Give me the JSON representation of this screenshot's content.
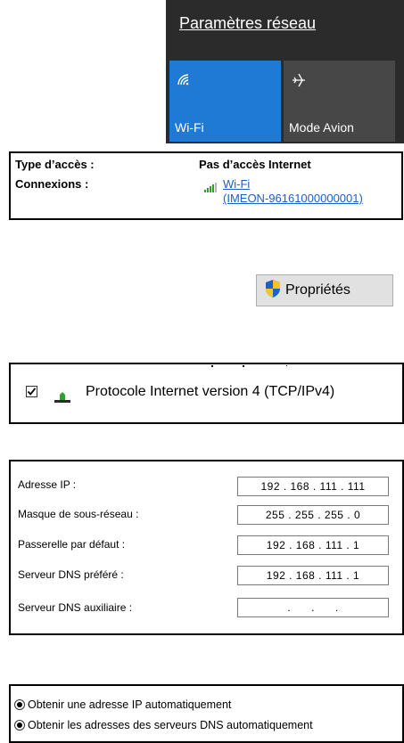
{
  "flyout": {
    "title": "Paramètres réseau",
    "tiles": [
      {
        "label": "Wi-Fi",
        "icon": "wifi-icon",
        "active": true,
        "color": "#1f7ad6"
      },
      {
        "label": "Mode Avion",
        "icon": "airplane-icon",
        "active": false,
        "color": "#474747"
      }
    ]
  },
  "access": {
    "type_label": "Type d’accès :",
    "type_value": "Pas d’accès Internet",
    "connections_label": "Connexions :",
    "connection_link_line1": "Wi-Fi",
    "connection_link_line2": "(IMEON-96161000000001)",
    "icon": "wifi-signal-icon"
  },
  "properties_button": {
    "label": "Propriétés",
    "icon": "uac-shield-icon"
  },
  "protocol": {
    "label": "Protocole Internet version 4 (TCP/IPv4)",
    "checked": true,
    "icon": "network-protocol-icon"
  },
  "ip_settings": [
    {
      "label": "Adresse IP :",
      "value": "192 . 168 . 111 . 111"
    },
    {
      "label": "Masque de sous-réseau :",
      "value": "255 . 255 . 255 .  0"
    },
    {
      "label": "Passerelle par défaut :",
      "value": "192 . 168 . 111 .  1"
    },
    {
      "label": "Serveur DNS préféré :",
      "value": "192 . 168 . 111 .  1"
    },
    {
      "label": "Serveur DNS auxiliaire :",
      "value": " .      .      . "
    }
  ],
  "options": [
    {
      "label": "Obtenir une adresse IP automatiquement",
      "selected": true
    },
    {
      "label": "Obtenir les adresses des serveurs DNS automatiquement",
      "selected": true
    }
  ]
}
